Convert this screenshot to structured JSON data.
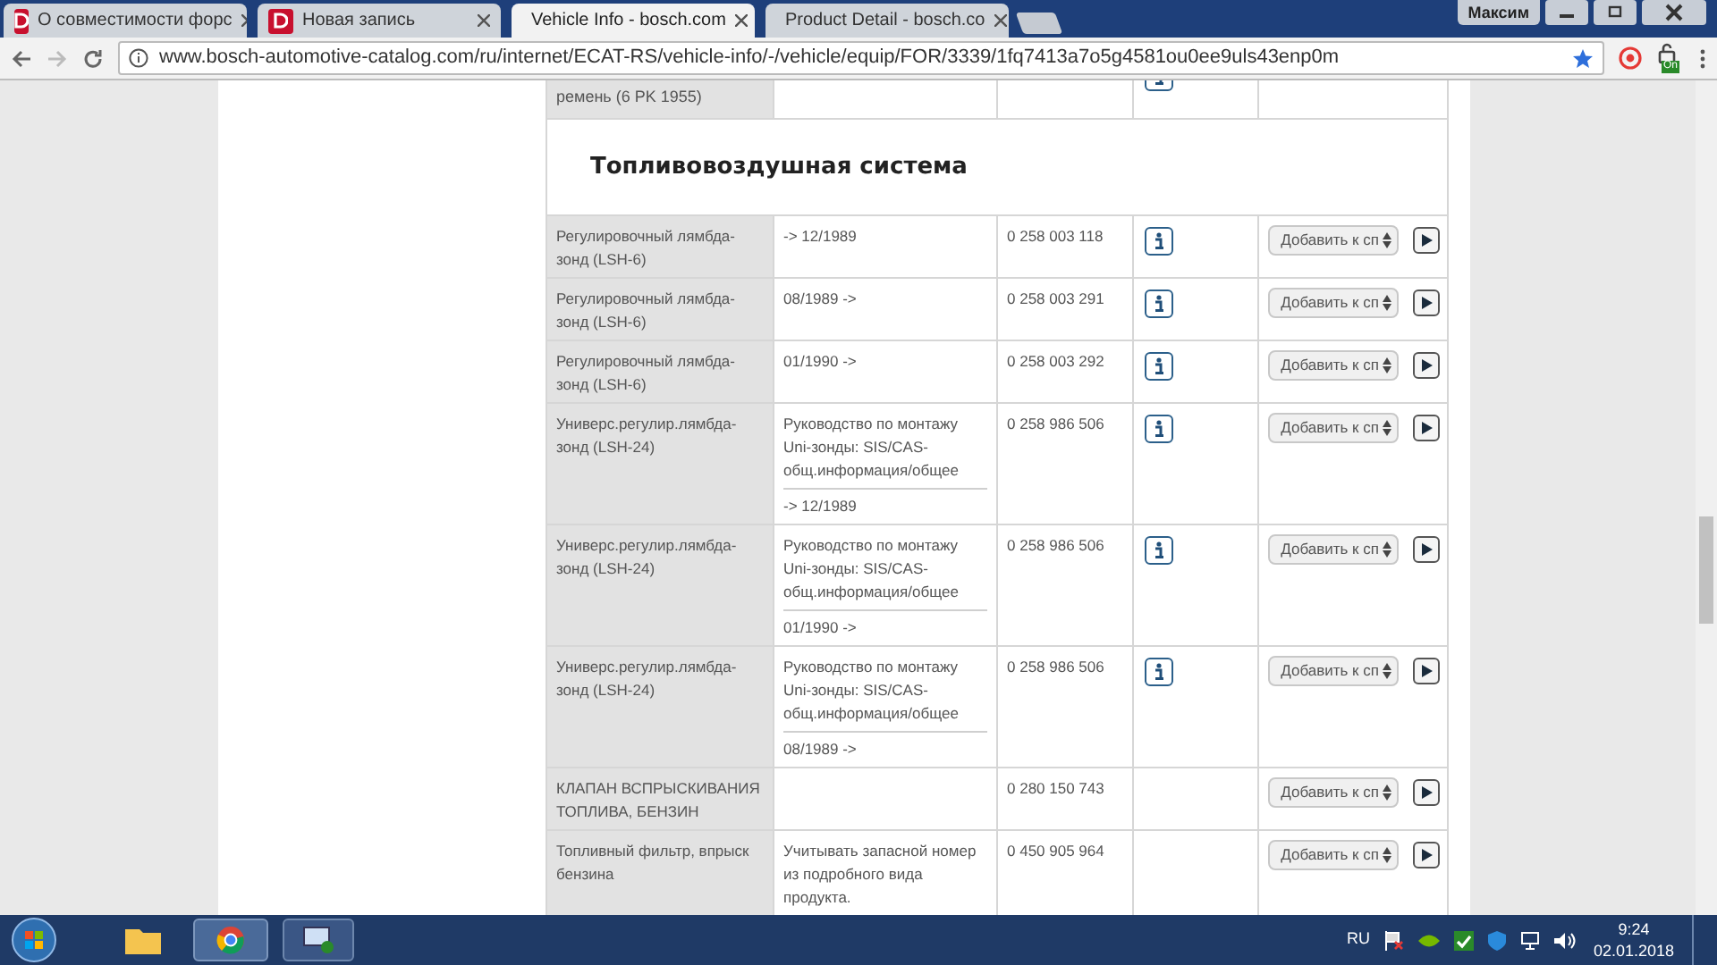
{
  "tabs": [
    {
      "title": "О совместимости форс",
      "selected": false
    },
    {
      "title": "Новая запись",
      "selected": false
    },
    {
      "title": "Vehicle Info - bosch.com",
      "selected": true
    },
    {
      "title": "Product Detail - bosch.co",
      "selected": false
    }
  ],
  "user": "Максим",
  "address": "www.bosch-automotive-catalog.com/ru/internet/ECAT-RS/vehicle-info/-/vehicle/equip/FOR/3339/1fq7413a7o5g4581ou0ee9uls43enp0m",
  "extension_badge": "On",
  "table": {
    "top_row": {
      "name": "ремень (6 PK 1955)",
      "has_info": true
    },
    "section_title": "Топливовоздушная система",
    "rows": [
      {
        "name": "Регулировочный лямбда-зонд (LSH-6)",
        "date": "-> 12/1989",
        "number": "0 258 003 118",
        "has_info": true,
        "select": "Добавить к сп"
      },
      {
        "name": "Регулировочный лямбда-зонд (LSH-6)",
        "date": "08/1989 ->",
        "number": "0 258 003 291",
        "has_info": true,
        "select": "Добавить к сп"
      },
      {
        "name": "Регулировочный лямбда-зонд (LSH-6)",
        "date": "01/1990 ->",
        "number": "0 258 003 292",
        "has_info": true,
        "select": "Добавить к сп"
      },
      {
        "name": "Универс.регулир.лямбда-зонд (LSH-24)",
        "note": "Руководство по монтажу Uni-зонды: SIS/CAS-общ.информация/общее",
        "date": "-> 12/1989",
        "number": "0 258 986 506",
        "has_info": true,
        "select": "Добавить к сп"
      },
      {
        "name": "Универс.регулир.лямбда-зонд (LSH-24)",
        "note": "Руководство по монтажу Uni-зонды: SIS/CAS-общ.информация/общее",
        "date": "01/1990 ->",
        "number": "0 258 986 506",
        "has_info": true,
        "select": "Добавить к сп"
      },
      {
        "name": "Универс.регулир.лямбда-зонд (LSH-24)",
        "note": "Руководство по монтажу Uni-зонды: SIS/CAS-общ.информация/общее",
        "date": "08/1989 ->",
        "number": "0 258 986 506",
        "has_info": true,
        "select": "Добавить к сп"
      },
      {
        "name": "КЛАПАН ВСПРЫСКИВАНИЯ ТОПЛИВА, БЕНЗИН",
        "number": "0 280 150 743",
        "has_info": false,
        "select": "Добавить к сп"
      },
      {
        "name": "Топливный фильтр, впрыск бензина",
        "note": "Учитывать запасной номер из подробного вида продукта.",
        "number": "0 450 905 964",
        "has_info": false,
        "select": "Добавить к сп"
      }
    ]
  },
  "taskbar": {
    "language": "RU",
    "time": "9:24",
    "date": "02.01.2018"
  }
}
